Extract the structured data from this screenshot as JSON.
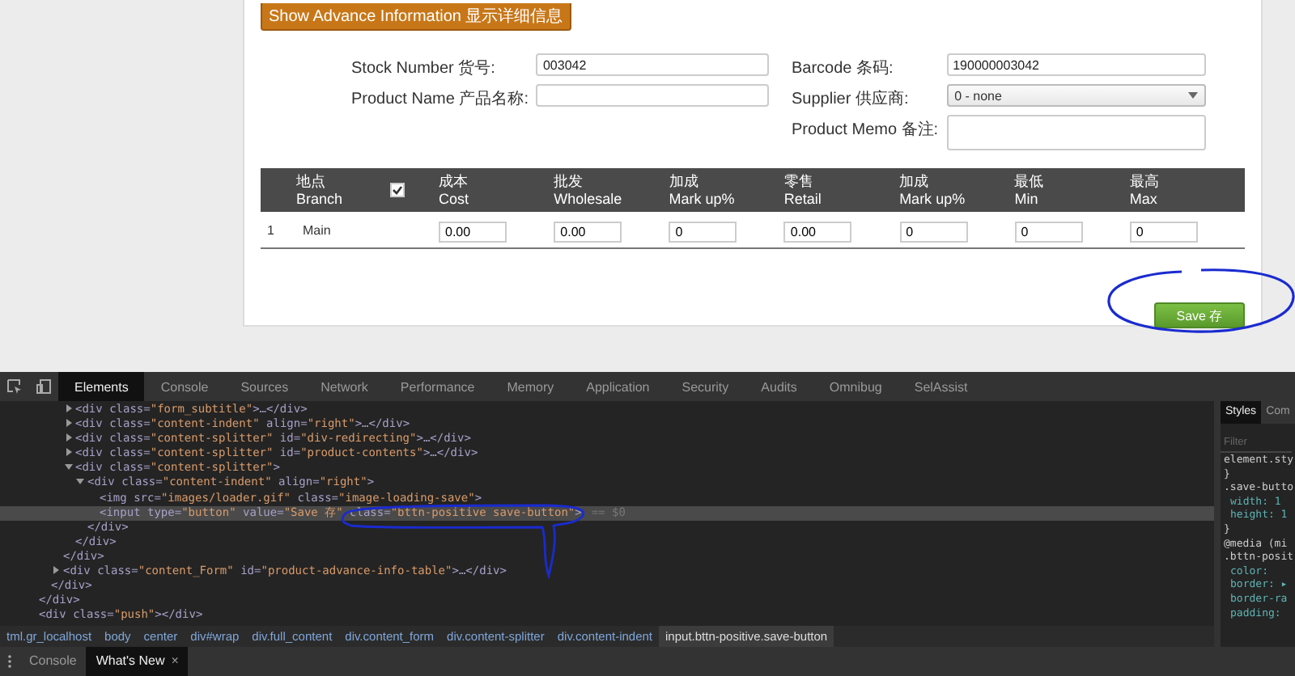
{
  "advance_button": {
    "label": "Show Advance Information 显示详细信息"
  },
  "form": {
    "left": [
      {
        "kind": "text",
        "label": "Stock Number 货号:",
        "value": "003042"
      },
      {
        "kind": "text",
        "label": "Product Name 产品名称:"
      }
    ],
    "right": [
      {
        "kind": "text",
        "label": "Barcode 条码:",
        "value": "190000003042"
      },
      {
        "kind": "select",
        "label": "Supplier 供应商:",
        "value": "0 - none"
      },
      {
        "kind": "textarea",
        "label": "Product Memo 备注:"
      }
    ]
  },
  "table": {
    "columns": [
      {
        "kind": "text",
        "lines": [
          "地点",
          "Branch"
        ]
      },
      {
        "kind": "checkbox",
        "checked": true
      },
      {
        "kind": "text",
        "lines": [
          "成本",
          "Cost"
        ]
      },
      {
        "kind": "text",
        "lines": [
          "批发",
          "Wholesale"
        ]
      },
      {
        "kind": "text",
        "lines": [
          "加成",
          "Mark up%"
        ]
      },
      {
        "kind": "text",
        "lines": [
          "零售",
          "Retail"
        ]
      },
      {
        "kind": "text",
        "lines": [
          "加成",
          "Mark up%"
        ]
      },
      {
        "kind": "text",
        "lines": [
          "最低",
          "Min"
        ]
      },
      {
        "kind": "text",
        "lines": [
          "最高",
          "Max"
        ]
      }
    ],
    "rows": [
      {
        "number": "1",
        "branch": "Main",
        "values": [
          "0.00",
          "0.00",
          "0",
          "0.00",
          "0",
          "0",
          "0"
        ]
      }
    ]
  },
  "save_button": {
    "label": "Save 存"
  },
  "devtools": {
    "tabs": [
      {
        "label": "Elements",
        "selected": true
      },
      {
        "label": "Console",
        "selected": false
      },
      {
        "label": "Sources",
        "selected": false
      },
      {
        "label": "Network",
        "selected": false
      },
      {
        "label": "Performance",
        "selected": false
      },
      {
        "label": "Memory",
        "selected": false
      },
      {
        "label": "Application",
        "selected": false
      },
      {
        "label": "Security",
        "selected": false
      },
      {
        "label": "Audits",
        "selected": false
      },
      {
        "label": "Omnibug",
        "selected": false
      },
      {
        "label": "SelAssist",
        "selected": false
      }
    ],
    "elements_tree": [
      {
        "close": "</div>",
        "children": [
          {
            "close": "</div>",
            "children": [
              {
                "close": "</div>",
                "children": [
                  {
                    "text": "<div class=\"form_subtitle\">…</div>",
                    "expanded": false,
                    "selected": false
                  },
                  {
                    "text": "<div class=\"content-indent\" align=\"right\">…</div>",
                    "expanded": false,
                    "selected": false
                  },
                  {
                    "text": "<div class=\"content-splitter\" id=\"div-redirecting\">…</div>",
                    "expanded": false,
                    "selected": false
                  },
                  {
                    "text": "<div class=\"content-splitter\" id=\"product-contents\">…</div>",
                    "expanded": false,
                    "selected": false
                  },
                  {
                    "text": "<div class=\"content-splitter\">",
                    "expanded": true,
                    "selected": false,
                    "close": "</div>",
                    "children": [
                      {
                        "text": "<div class=\"content-indent\" align=\"right\">",
                        "expanded": true,
                        "selected": false,
                        "close": "</div>",
                        "children": [
                          {
                            "text": "<img src=\"images/loader.gif\" class=\"image-loading-save\">",
                            "selected": false
                          },
                          {
                            "text": "<input type=\"button\" value=\"Save 存\" class=\"bttn-positive save-button\">",
                            "suffix": "== $0",
                            "selected": true
                          }
                        ]
                      }
                    ]
                  }
                ]
              },
              {
                "text": "<div class=\"content_Form\" id=\"product-advance-info-table\">…</div>",
                "expanded": false,
                "selected": false
              }
            ]
          }
        ]
      },
      {
        "text": "<div class=\"push\"></div>",
        "selected": false
      }
    ],
    "breadcrumbs": [
      {
        "label": "tml.gr_localhost",
        "selected": false
      },
      {
        "label": "body",
        "selected": false
      },
      {
        "label": "center",
        "selected": false
      },
      {
        "label": "div#wrap",
        "selected": false
      },
      {
        "label": "div.full_content",
        "selected": false
      },
      {
        "label": "div.content_form",
        "selected": false
      },
      {
        "label": "div.content-splitter",
        "selected": false
      },
      {
        "label": "div.content-indent",
        "selected": false
      },
      {
        "label": "input.bttn-positive.save-button",
        "selected": true
      }
    ],
    "styles_tabs": [
      {
        "label": "Styles",
        "selected": true
      },
      {
        "label": "Com",
        "selected": false
      }
    ],
    "styles_filter": {
      "placeholder": "Filter"
    },
    "styles_lines": [
      {
        "kind": "selector",
        "text": "element.sty"
      },
      {
        "kind": "brace",
        "text": "}"
      },
      {
        "kind": "selector",
        "text": ".save-butto"
      },
      {
        "kind": "prop",
        "text": "width: 1"
      },
      {
        "kind": "prop",
        "text": "height: 1"
      },
      {
        "kind": "brace",
        "text": "}"
      },
      {
        "kind": "selector",
        "text": "@media (mi"
      },
      {
        "kind": "selector",
        "text": ".bttn-posit"
      },
      {
        "kind": "prop",
        "text": "color:"
      },
      {
        "kind": "prop",
        "text": "border: ▸"
      },
      {
        "kind": "prop",
        "text": "border-ra"
      },
      {
        "kind": "prop",
        "text": "padding:"
      }
    ],
    "drawer_tabs": [
      {
        "label": "Console",
        "selected": false
      },
      {
        "label": "What's New",
        "selected": true,
        "close": "×"
      }
    ]
  }
}
